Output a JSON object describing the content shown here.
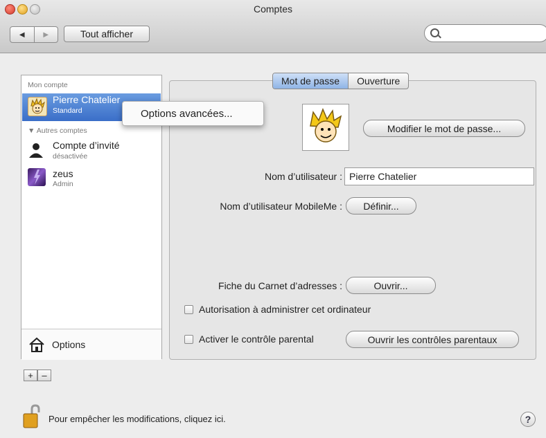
{
  "window": {
    "title": "Comptes",
    "show_all_label": "Tout afficher",
    "search_value": ""
  },
  "sidebar": {
    "my_account_header": "Mon compte",
    "current_user": {
      "name": "Pierre Chatelier",
      "role": "Standard"
    },
    "other_accounts_header": "Autres comptes",
    "other_accounts": [
      {
        "name": "Compte d’invité",
        "status": "désactivée",
        "icon": "person-silhouette-icon"
      },
      {
        "name": "zeus",
        "status": "Admin",
        "icon": "purple-lightning-avatar-icon"
      }
    ],
    "options_label": "Options"
  },
  "context_menu": {
    "item": "Options avancées..."
  },
  "tabs": [
    {
      "label": "Mot de passe",
      "active": true
    },
    {
      "label": "Ouverture",
      "active": false
    }
  ],
  "main": {
    "change_password_button": "Modifier le mot de passe...",
    "username_label": "Nom d’utilisateur :",
    "username_value": "Pierre Chatelier",
    "mobileme_label": "Nom d’utilisateur MobileMe :",
    "mobileme_button": "Définir...",
    "addressbook_label": "Fiche du Carnet d’adresses :",
    "addressbook_button": "Ouvrir...",
    "admin_checkbox_label": "Autorisation à administrer cet ordinateur",
    "parental_checkbox_label": "Activer le contrôle parental",
    "parental_button": "Ouvrir les contrôles parentaux"
  },
  "footer": {
    "add_label": "+",
    "remove_label": "–",
    "lock_text": "Pour empêcher les modifications, cliquez ici.",
    "help_label": "?"
  },
  "colors": {
    "selection": "#3a6ec8",
    "active_tab": "#8fb4e6"
  }
}
